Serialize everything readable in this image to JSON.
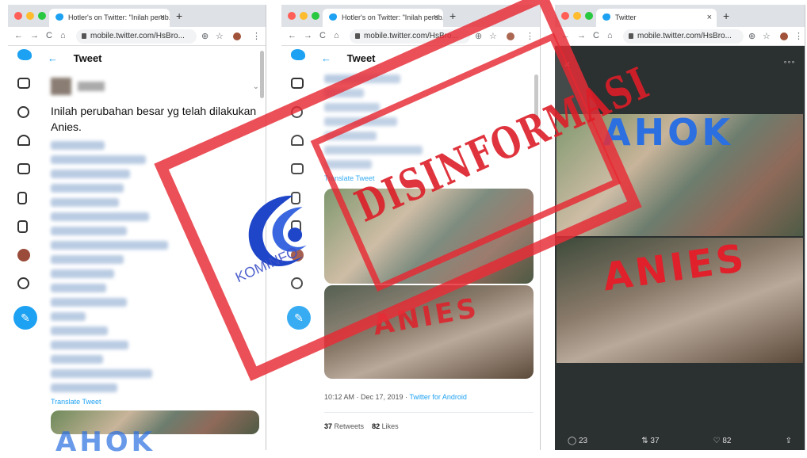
{
  "browser": {
    "tab_title_1": "Hotler's on Twitter: \"Inilah perub...",
    "tab_title_2": "Hotler's on Twitter: \"Inilah perub...",
    "tab_title_3": "Twitter",
    "tab_close": "×",
    "new_tab": "+",
    "url": "mobile.twitter.com/HsBro...",
    "nav_back": "←",
    "nav_forward": "→",
    "nav_reload": "C",
    "nav_home": "⌂",
    "addr_add": "⊕",
    "addr_star": "☆",
    "addr_menu": "⋮"
  },
  "header": {
    "back_arrow": "←",
    "title": "Tweet"
  },
  "tweet": {
    "text": "Inilah perubahan besar yg telah dilakukan Anies.",
    "translate_label": "Translate Tweet",
    "timestamp": "10:12 AM · Dec 17, 2019",
    "source": "Twitter for Android",
    "retweets_count": "37",
    "retweets_label": "Retweets",
    "likes_count": "82",
    "likes_label": "Likes"
  },
  "image_viewer": {
    "close": "×",
    "more": "∘∘∘",
    "reply_count": "23",
    "retweet_count": "37",
    "like_count": "82"
  },
  "overlay": {
    "stamp_text": "DISINFORMASI",
    "logo_text": "KOMINFO",
    "drawn_ahok": "AHOK",
    "drawn_anies": "ANIES"
  },
  "colors": {
    "twitter_blue": "#1da1f2",
    "stamp_red": "#e6282f",
    "logo_blue": "#2d4fc8"
  }
}
